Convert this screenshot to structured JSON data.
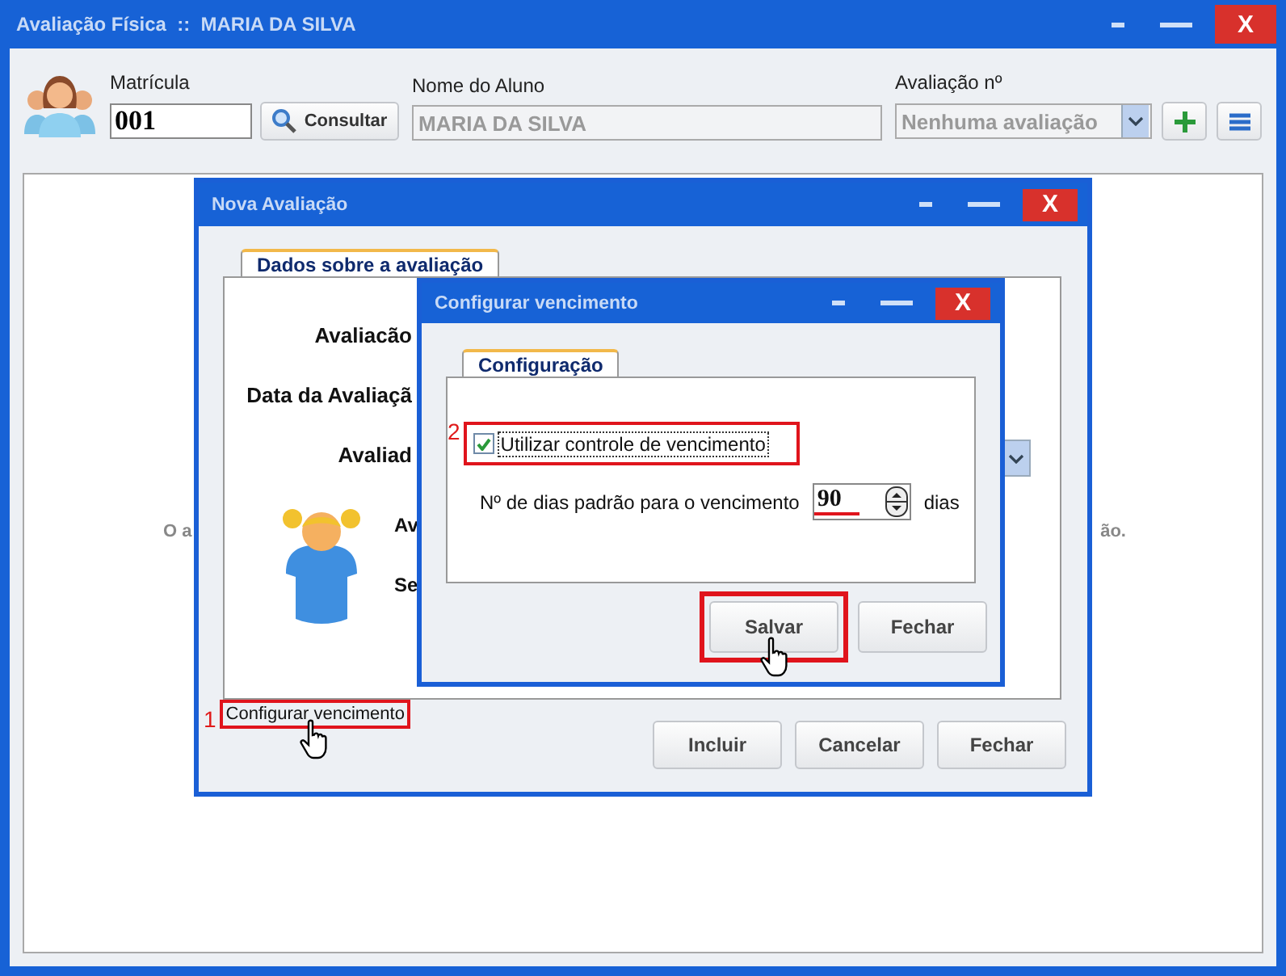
{
  "window": {
    "title": "Avaliação Física  ::  MARIA DA SILVA",
    "close": "X"
  },
  "header": {
    "registration": {
      "label": "Matrícula",
      "value": "001"
    },
    "search_button": "Consultar",
    "student": {
      "label": "Nome do Aluno",
      "value": "MARIA DA SILVA",
      "disabled": true
    },
    "evaluation": {
      "label": "Avaliação nº",
      "value": "Nenhuma avaliação",
      "disabled": true
    }
  },
  "background_message": [
    "O a",
    "ão."
  ],
  "new_evaluation_dialog": {
    "title": "Nova Avaliação",
    "close": "X",
    "tabs": [
      {
        "label": "Dados sobre a avaliação",
        "selected": true
      }
    ],
    "labels": [
      "Avaliacão",
      "Data da Avaliaçã",
      "Avaliad"
    ],
    "side_labels": [
      "Av",
      "Se"
    ],
    "link": {
      "label": "Configurar vencimento",
      "step": "1"
    },
    "buttons": [
      "Incluir",
      "Cancelar",
      "Fechar"
    ]
  },
  "config_dialog": {
    "title": "Configurar vencimento",
    "close": "X",
    "tabs": [
      {
        "label": "Configuração",
        "selected": true
      }
    ],
    "checkbox": {
      "label": "Utilizar controle de vencimento",
      "checked": true,
      "step": "2"
    },
    "days": {
      "label": "Nº de dias padrão para o vencimento",
      "value": "90",
      "unit": "dias"
    },
    "buttons": [
      {
        "label": "Salvar",
        "highlighted": true
      },
      {
        "label": "Fechar",
        "highlighted": false
      }
    ]
  }
}
